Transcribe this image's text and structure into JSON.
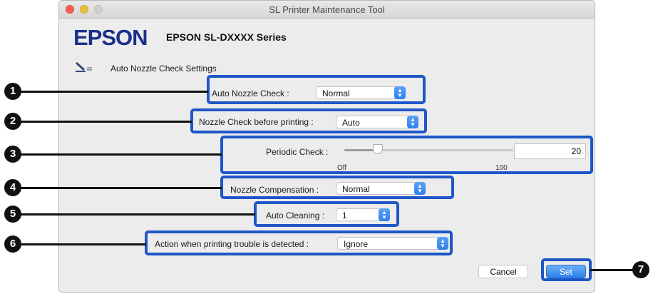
{
  "window": {
    "title": "SL Printer Maintenance Tool"
  },
  "header": {
    "brand": "EPSON",
    "model": "EPSON SL-DXXXX Series"
  },
  "section": {
    "title": "Auto Nozzle Check Settings",
    "icon": "nozzle-check-icon"
  },
  "settings": {
    "auto_nozzle_check": {
      "label": "Auto Nozzle Check :",
      "value": "Normal"
    },
    "nozzle_check_before_printing": {
      "label": "Nozzle Check before printing :",
      "value": "Auto"
    },
    "periodic_check": {
      "label": "Periodic Check :",
      "value": "20",
      "min_label": "Off",
      "max_label": "100",
      "min": 0,
      "max": 100,
      "level": 20
    },
    "nozzle_compensation": {
      "label": "Nozzle Compensation :",
      "value": "Normal"
    },
    "auto_cleaning": {
      "label": "Auto Cleaning :",
      "value": "1"
    },
    "action_on_trouble": {
      "label": "Action when printing trouble is detected :",
      "value": "Ignore"
    }
  },
  "buttons": {
    "cancel": "Cancel",
    "set": "Set"
  },
  "callouts": [
    "1",
    "2",
    "3",
    "4",
    "5",
    "6",
    "7"
  ],
  "colors": {
    "highlight": "#1e56c8",
    "brand": "#1b2f8c",
    "accent": "#2d7fea"
  }
}
